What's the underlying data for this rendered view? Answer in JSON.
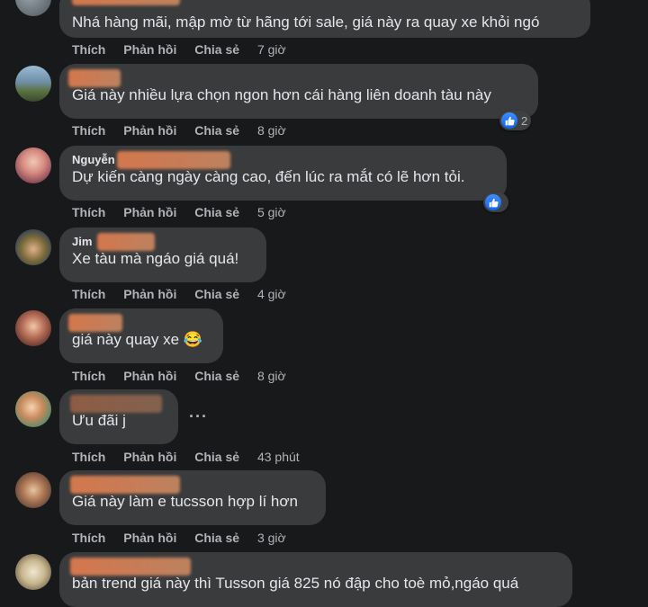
{
  "actions": {
    "like": "Thích",
    "reply": "Phản hồi",
    "share": "Chia sẻ"
  },
  "comments": [
    {
      "author": "",
      "text": "Nhá hàng mãi, mập mờ từ hãng tới sale, giá này ra quay xe khỏi ngó",
      "time": "7 giờ"
    },
    {
      "author": "",
      "text": "Giá này nhiều lựa chọn ngon hơn cái hàng liên doanh tàu này",
      "time": "8 giờ",
      "reaction_count": "2"
    },
    {
      "author": "Nguyễn",
      "text": "Dự kiến càng ngày càng cao, đến lúc ra mắt có lẽ hơn tỏi.",
      "time": "5 giờ",
      "reaction_count": ""
    },
    {
      "author": "Jim",
      "text": "Xe tàu mà ngáo giá quá!",
      "time": "4 giờ"
    },
    {
      "author": "",
      "text": "giá này quay xe 😂",
      "time": "8 giờ"
    },
    {
      "author": "",
      "text": "Ưu đãi j",
      "time": "43 phút",
      "more": "···"
    },
    {
      "author": "",
      "text": "Giá này làm e tucsson hợp lí hơn",
      "time": "3 giờ"
    },
    {
      "author": "",
      "text": "bản trend giá này thì Tusson giá 825 nó đập cho toè mỏ,ngáo quá",
      "time": ""
    }
  ],
  "colors": {
    "background": "#18191a",
    "bubble": "#3a3b3c",
    "text": "#e4e6eb",
    "secondary_text": "#b0b3b8",
    "like_blue": "#1877f2"
  },
  "icons": {
    "reaction": "like-icon",
    "more": "more-options-icon"
  }
}
